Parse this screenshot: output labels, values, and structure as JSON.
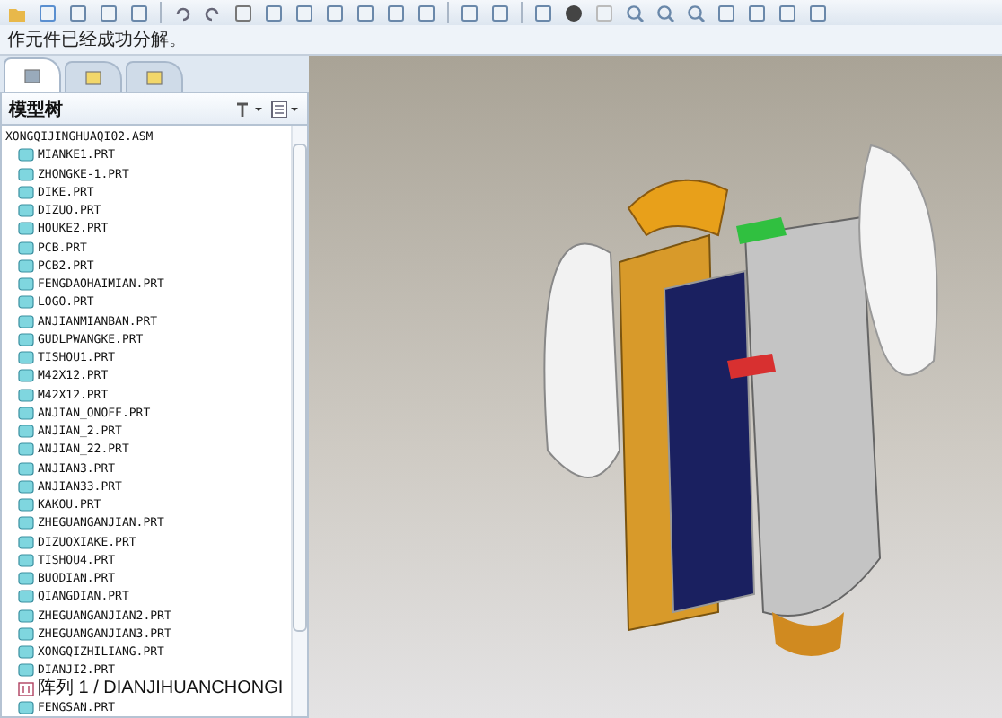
{
  "status_message": "作元件已经成功分解。",
  "navigator_tabs": [
    {
      "selected": true
    },
    {
      "selected": false
    },
    {
      "selected": false
    }
  ],
  "model_tree": {
    "title": "模型树",
    "root": {
      "label": "XONGQIJINGHUAQI02.ASM",
      "children": [
        {
          "kind": "part",
          "label": "MIANKE1.PRT"
        },
        {
          "kind": "part",
          "label": "ZHONGKE-1.PRT"
        },
        {
          "kind": "part",
          "label": "DIKE.PRT"
        },
        {
          "kind": "part",
          "label": "DIZUO.PRT"
        },
        {
          "kind": "part",
          "label": "HOUKE2.PRT"
        },
        {
          "kind": "part",
          "label": "PCB.PRT"
        },
        {
          "kind": "part",
          "label": "PCB2.PRT"
        },
        {
          "kind": "part",
          "label": "FENGDAOHAIMIAN.PRT"
        },
        {
          "kind": "part",
          "label": "LOGO.PRT"
        },
        {
          "kind": "part",
          "label": "ANJIANMIANBAN.PRT"
        },
        {
          "kind": "part",
          "label": "GUDLPWANGKE.PRT"
        },
        {
          "kind": "part",
          "label": "TISHOU1.PRT"
        },
        {
          "kind": "part",
          "label": "M42X12.PRT"
        },
        {
          "kind": "part",
          "label": "M42X12.PRT"
        },
        {
          "kind": "part",
          "label": "ANJIAN_ONOFF.PRT"
        },
        {
          "kind": "part",
          "label": "ANJIAN_2.PRT"
        },
        {
          "kind": "part",
          "label": "ANJIAN_22.PRT"
        },
        {
          "kind": "part",
          "label": "ANJIAN3.PRT"
        },
        {
          "kind": "part",
          "label": "ANJIAN33.PRT"
        },
        {
          "kind": "part",
          "label": "KAKOU.PRT"
        },
        {
          "kind": "part",
          "label": "ZHEGUANGANJIAN.PRT"
        },
        {
          "kind": "part",
          "label": "DIZUOXIAKE.PRT"
        },
        {
          "kind": "part",
          "label": "TISHOU4.PRT"
        },
        {
          "kind": "part",
          "label": "BUODIAN.PRT"
        },
        {
          "kind": "part",
          "label": "QIANGDIAN.PRT"
        },
        {
          "kind": "part",
          "label": "ZHEGUANGANJIAN2.PRT"
        },
        {
          "kind": "part",
          "label": "ZHEGUANGANJIAN3.PRT"
        },
        {
          "kind": "part",
          "label": "XONGQIZHILIANG.PRT"
        },
        {
          "kind": "part",
          "label": "DIANJI2.PRT"
        },
        {
          "kind": "pattern",
          "label": "阵列 1 / DIANJIHUANCHONGI"
        },
        {
          "kind": "part",
          "label": "FENGSAN.PRT"
        }
      ]
    }
  }
}
